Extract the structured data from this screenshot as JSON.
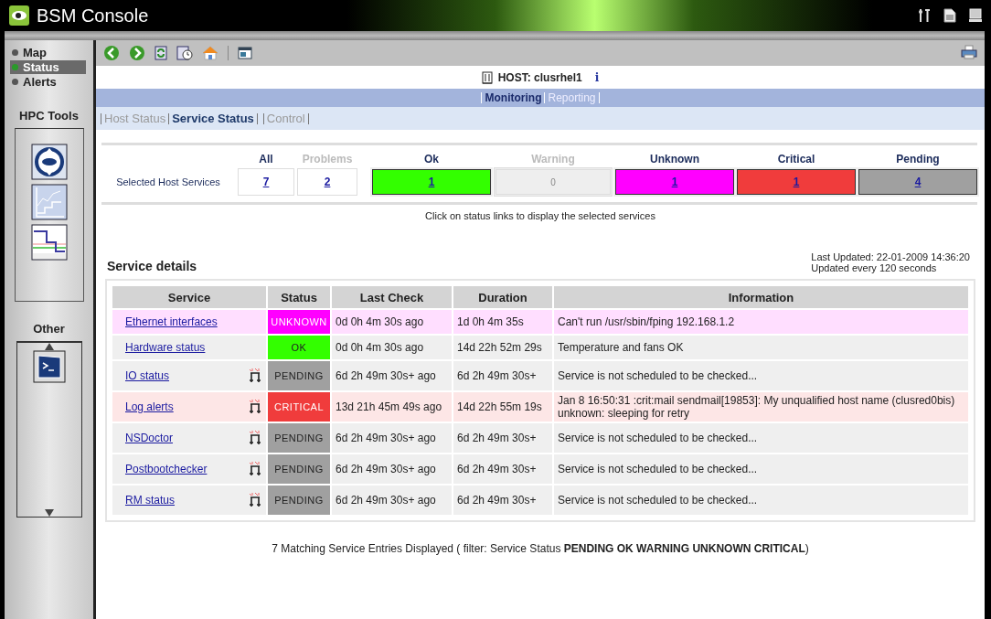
{
  "window": {
    "title": "BSM Console"
  },
  "sidebar": {
    "nav": [
      {
        "label": "Map",
        "selected": false
      },
      {
        "label": "Status",
        "selected": true
      },
      {
        "label": "Alerts",
        "selected": false
      }
    ],
    "sections": [
      {
        "title": "HPC Tools",
        "kind": "tools"
      },
      {
        "title": "Other",
        "kind": "scroller"
      }
    ]
  },
  "host": {
    "label": "HOST: clusrhel1",
    "info": "i"
  },
  "view_tabs": [
    {
      "label": "Monitoring",
      "selected": true
    },
    {
      "label": "Reporting",
      "selected": false
    }
  ],
  "sub_tabs": [
    {
      "label": "Host Status",
      "selected": false
    },
    {
      "label": "Service Status",
      "selected": true
    },
    {
      "label": "Control",
      "selected": false
    }
  ],
  "summary": {
    "row_label": "Selected Host Services",
    "columns": [
      {
        "label": "All",
        "value": "7",
        "kind": "count",
        "disabled": false
      },
      {
        "label": "Problems",
        "value": "2",
        "kind": "count",
        "disabled": true
      },
      {
        "label": "Ok",
        "value": "1",
        "kind": "status",
        "disabled": false,
        "color": "#33ff00"
      },
      {
        "label": "Warning",
        "value": "0",
        "kind": "status",
        "disabled": true,
        "color": "#eeeeee"
      },
      {
        "label": "Unknown",
        "value": "1",
        "kind": "status",
        "disabled": false,
        "color": "#ff00ff"
      },
      {
        "label": "Critical",
        "value": "1",
        "kind": "status",
        "disabled": false,
        "color": "#f03c3c"
      },
      {
        "label": "Pending",
        "value": "4",
        "kind": "status",
        "disabled": false,
        "color": "#a0a0a0"
      }
    ]
  },
  "note": "Click on status links to display the selected services",
  "details": {
    "title": "Service details",
    "last_updated": "Last Updated: 22-01-2009 14:36:20",
    "refresh": "Updated every 120 seconds"
  },
  "table": {
    "columns": [
      "Service",
      "Status",
      "Last Check",
      "Duration",
      "Information"
    ],
    "rows": [
      {
        "service": "Ethernet interfaces",
        "easy": false,
        "status": "UNKNOWN",
        "color": "#ff00ff",
        "highlighted": true,
        "last_check": "0d 0h 4m 30s ago",
        "duration": "1d 0h 4m 35s",
        "information": "Can't run /usr/sbin/fping 192.168.1.2"
      },
      {
        "service": "Hardware status",
        "easy": false,
        "status": "OK",
        "color": "#33ff00",
        "highlighted": false,
        "last_check": "0d 0h 4m 30s ago",
        "duration": "14d 22h 52m 29s",
        "information": "Temperature and fans OK"
      },
      {
        "service": "IO status",
        "easy": true,
        "status": "PENDING",
        "color": "#a0a0a0",
        "highlighted": false,
        "last_check": "6d 2h 49m 30s+ ago",
        "duration": "6d 2h 49m 30s+",
        "information": "Service is not scheduled to be checked..."
      },
      {
        "service": "Log alerts",
        "easy": true,
        "status": "CRITICAL",
        "color": "#f03c3c",
        "highlighted": true,
        "last_check": "13d 21h 45m 49s ago",
        "duration": "14d 22h 55m 19s",
        "information": "Jan 8 16:50:31 :crit:mail sendmail[19853]: My unqualified host name (clusred0bis) unknown: sleeping for retry"
      },
      {
        "service": "NSDoctor",
        "easy": true,
        "status": "PENDING",
        "color": "#a0a0a0",
        "highlighted": false,
        "last_check": "6d 2h 49m 30s+ ago",
        "duration": "6d 2h 49m 30s+",
        "information": "Service is not scheduled to be checked..."
      },
      {
        "service": "Postbootchecker",
        "easy": true,
        "status": "PENDING",
        "color": "#a0a0a0",
        "highlighted": false,
        "last_check": "6d 2h 49m 30s+ ago",
        "duration": "6d 2h 49m 30s+",
        "information": "Service is not scheduled to be checked..."
      },
      {
        "service": "RM status",
        "easy": true,
        "status": "PENDING",
        "color": "#a0a0a0",
        "highlighted": false,
        "last_check": "6d 2h 49m 30s+ ago",
        "duration": "6d 2h 49m 30s+",
        "information": "Service is not scheduled to be checked..."
      }
    ]
  },
  "footer": "7 Matching Service Entries Displayed ( filter: Service Status **PENDING OK WARNING UNKNOWN CRITICAL**)"
}
